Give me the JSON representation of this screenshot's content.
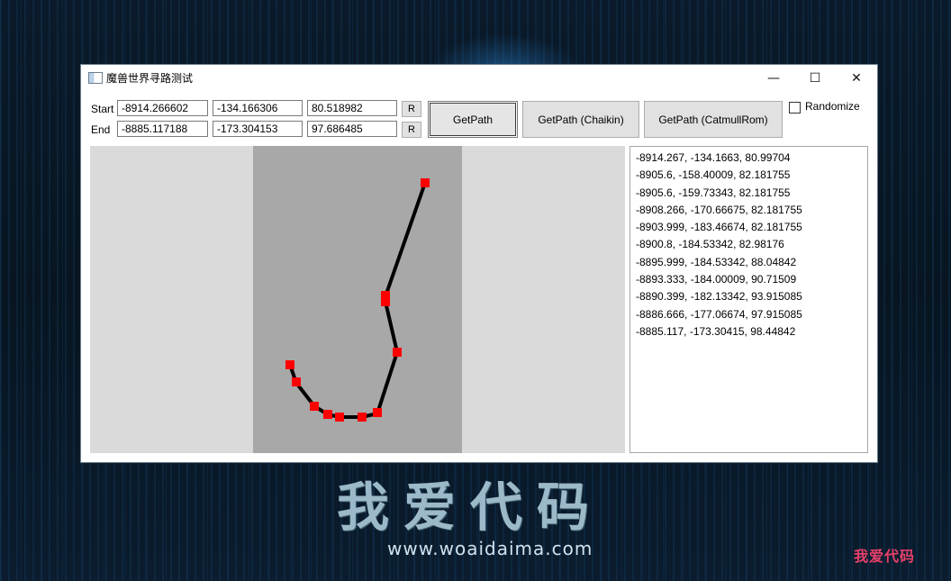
{
  "window": {
    "title": "魔兽世界寻路测试",
    "icon": "app-window-icon",
    "controls": {
      "minimize": "—",
      "maximize": "☐",
      "close": "✕"
    }
  },
  "start": {
    "label": "Start",
    "x": "-8914.266602",
    "y": "-134.166306",
    "z": "80.518982",
    "random_button": "R"
  },
  "end": {
    "label": "End",
    "x": "-8885.117188",
    "y": "-173.304153",
    "z": "97.686485",
    "random_button": "R"
  },
  "buttons": {
    "getpath": "GetPath",
    "getpath_chaikin": "GetPath (Chaikin)",
    "getpath_catmull": "GetPath (CatmullRom)"
  },
  "randomize": {
    "label": "Randomize",
    "checked": false
  },
  "path": {
    "points": [
      "-8914.267, -134.1663, 80.99704",
      "-8905.6, -158.40009, 82.181755",
      "-8905.6, -159.73343, 82.181755",
      "-8908.266, -170.66675, 82.181755",
      "-8903.999, -183.46674, 82.181755",
      "-8900.8, -184.53342, 82.98176",
      "-8895.999, -184.53342, 88.04842",
      "-8893.333, -184.00009, 90.71509",
      "-8890.399, -182.13342, 93.915085",
      "-8886.666, -177.06674, 97.915085",
      "-8885.117, -173.30415, 98.44842"
    ]
  },
  "colors": {
    "canvas_bg": "#dadada",
    "tile_bg": "#a8a8a8",
    "path_line": "#000000",
    "waypoint": "#ff0000",
    "desktop_bg": "#07121d"
  },
  "watermark": {
    "text": "我爱代码",
    "url": "www.woaidaima.com",
    "stamp": "我爱代码"
  }
}
